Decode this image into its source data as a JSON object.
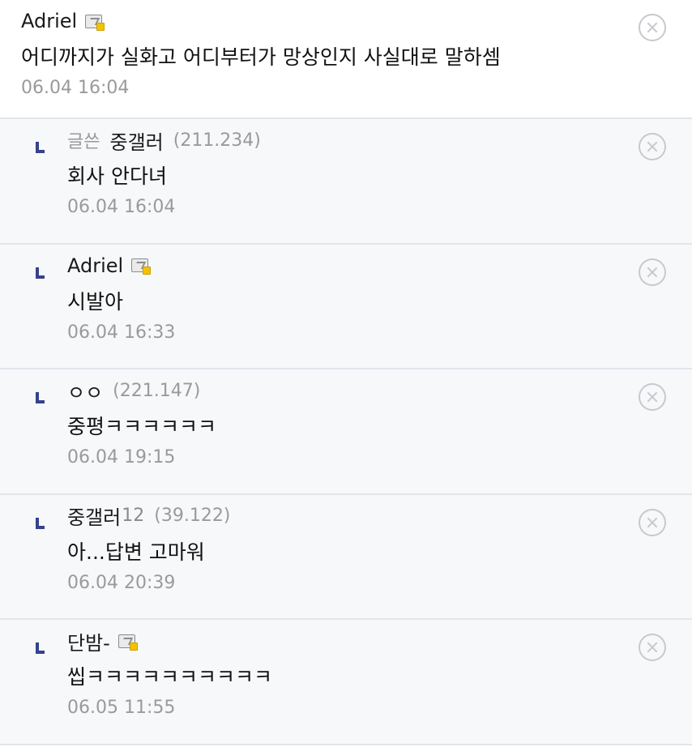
{
  "comments": [
    {
      "nick": "Adriel",
      "has_icon": true,
      "text": "어디까지가 실화고 어디부터가 망상인지 사실대로 말하셈",
      "date": "06.04 16:04"
    },
    {
      "writer_tag": "글쓴",
      "nick": "중갤러",
      "ip": "(211.234)",
      "text": "회사 안다녀",
      "date": "06.04 16:04"
    },
    {
      "nick": "Adriel",
      "has_icon": true,
      "text": "시발아",
      "date": "06.04 16:33"
    },
    {
      "nick": "ㅇㅇ",
      "ip": "(221.147)",
      "text": "중평ㅋㅋㅋㅋㅋㅋ",
      "date": "06.04 19:15"
    },
    {
      "nick": "중갤러",
      "nick_suffix": "12",
      "ip": "(39.122)",
      "text": "아...답변 고마워",
      "date": "06.04 20:39"
    },
    {
      "nick": "단밤-",
      "has_icon": true,
      "text": "씹ㅋㅋㅋㅋㅋㅋㅋㅋㅋㅋ",
      "date": "06.05 11:55"
    }
  ],
  "icons": {
    "delete": "close-circle-icon",
    "reply": "reply-arrow-icon",
    "gonick": "gallery-nick-icon"
  },
  "colors": {
    "reply_mark": "#36428c",
    "reply_bg": "#f7f8fa",
    "muted_text": "#9a9a9a"
  }
}
